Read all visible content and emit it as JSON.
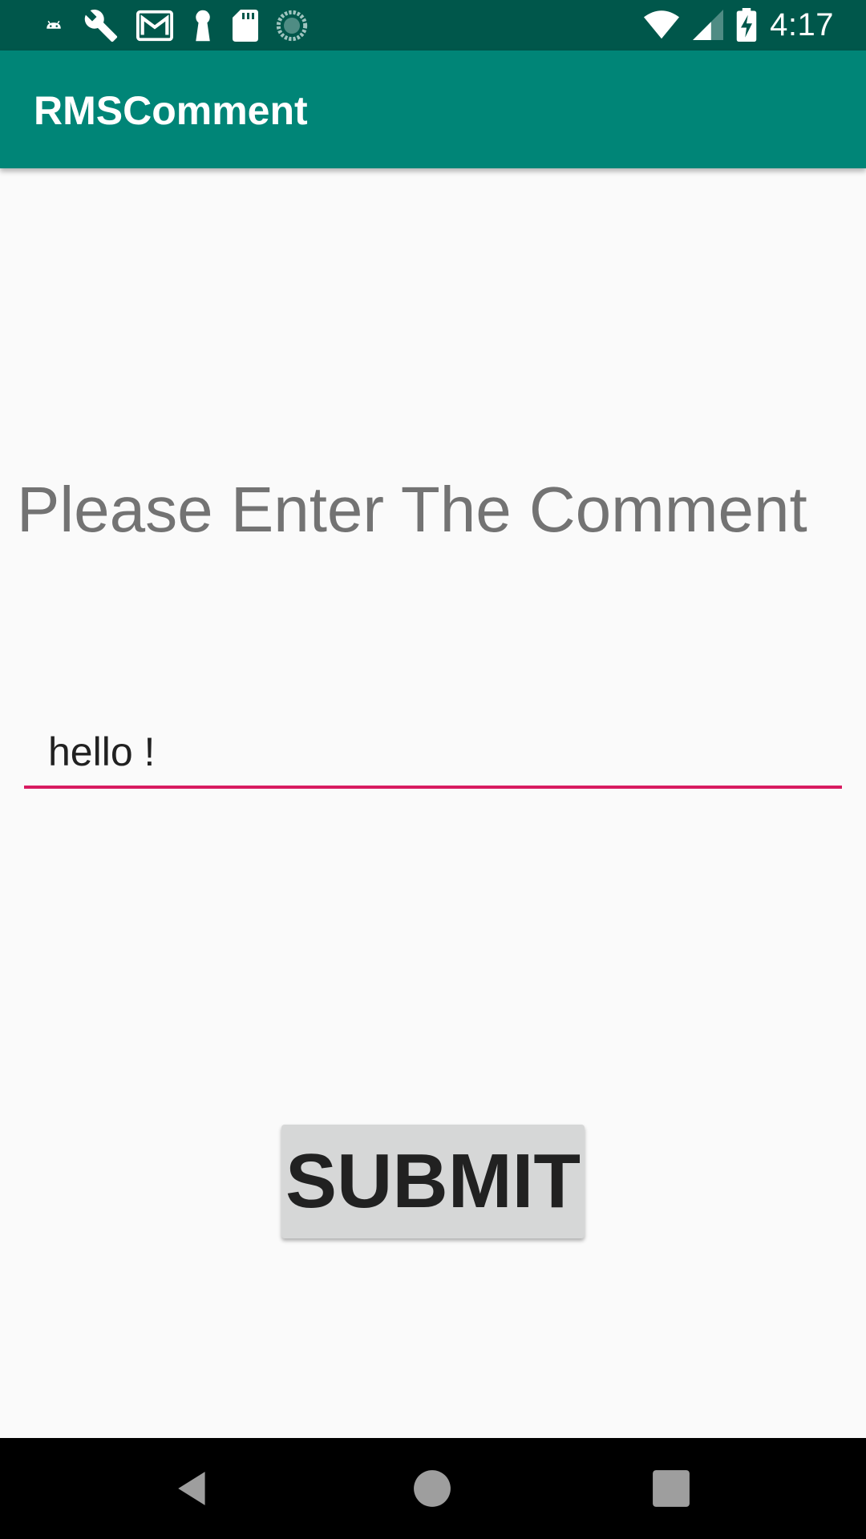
{
  "status_bar": {
    "time": "4:17",
    "notification_icons": [
      "android-icon",
      "wrench-icon",
      "gmail-icon",
      "keyhole-icon",
      "sd-card-icon",
      "sync-spinner-icon"
    ],
    "system_icons": [
      "wifi-icon",
      "signal-icon",
      "battery-charging-icon"
    ]
  },
  "app_bar": {
    "title": "RMSComment"
  },
  "main": {
    "prompt": "Please Enter The Comment",
    "comment_input_value": "hello !",
    "submit_label": "SUBMIT"
  },
  "nav_bar": {
    "buttons": [
      "back-icon",
      "home-icon",
      "recents-icon"
    ]
  },
  "colors": {
    "status_bar": "#00574b",
    "app_bar": "#008577",
    "accent": "#d81b60",
    "background": "#fafafa",
    "button": "#d6d7d7"
  }
}
